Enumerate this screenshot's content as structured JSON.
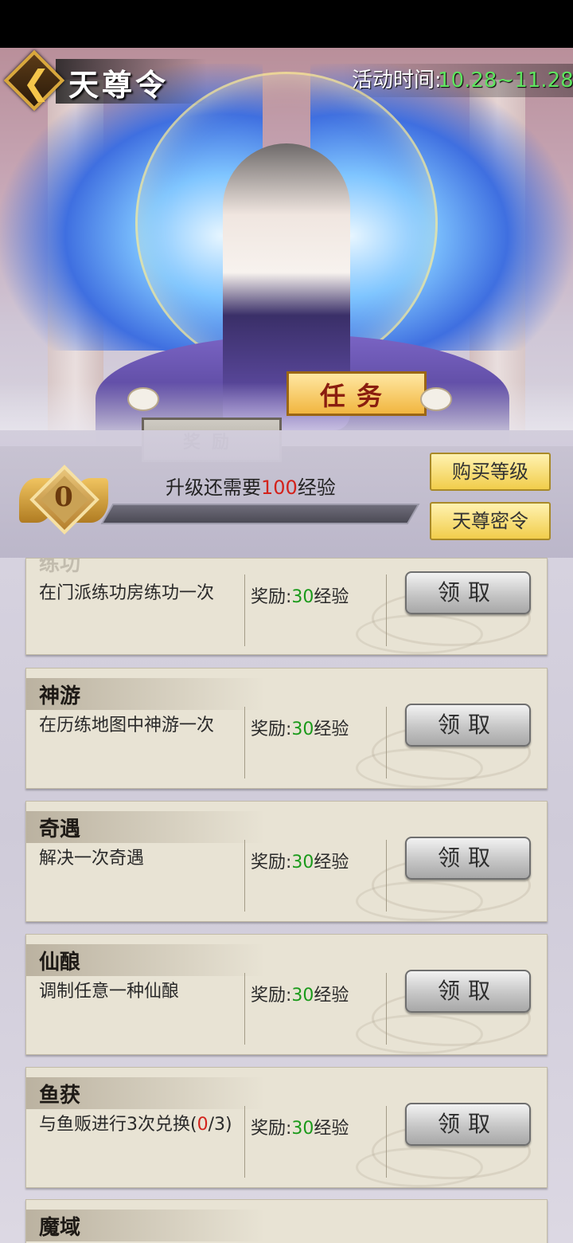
{
  "header": {
    "title": "天尊令",
    "activity_label": "活动时间:",
    "activity_range": "10.28~11.28"
  },
  "tabs": [
    {
      "label": "奖励",
      "active": false
    },
    {
      "label": "任务",
      "active": true
    }
  ],
  "level": {
    "current": "0",
    "need_prefix": "升级还需要",
    "need_value": "100",
    "need_suffix": "经验",
    "progress_fraction": 0
  },
  "buttons": {
    "buy_level": "购买等级",
    "secret_order": "天尊密令"
  },
  "tasks": [
    {
      "name": "练功",
      "desc": "在门派练功房练功一次",
      "reward_label": "奖励:",
      "reward_value": "30",
      "reward_unit": "经验",
      "button": "领取"
    },
    {
      "name": "神游",
      "desc": "在历练地图中神游一次",
      "reward_label": "奖励:",
      "reward_value": "30",
      "reward_unit": "经验",
      "button": "领取"
    },
    {
      "name": "奇遇",
      "desc": "解决一次奇遇",
      "reward_label": "奖励:",
      "reward_value": "30",
      "reward_unit": "经验",
      "button": "领取"
    },
    {
      "name": "仙酿",
      "desc": "调制任意一种仙酿",
      "reward_label": "奖励:",
      "reward_value": "30",
      "reward_unit": "经验",
      "button": "领取"
    },
    {
      "name": "鱼获",
      "desc_prefix": "与鱼贩进行3次兑换(",
      "desc_progress": "0",
      "desc_suffix": "/3)",
      "reward_label": "奖励:",
      "reward_value": "30",
      "reward_unit": "经验",
      "button": "领取"
    },
    {
      "name": "魔域"
    }
  ],
  "colors": {
    "accent_gold": "#f1cd4b",
    "reward_green": "#1b9a1b",
    "warning_red": "#d3221b",
    "date_green": "#5fe35f"
  }
}
